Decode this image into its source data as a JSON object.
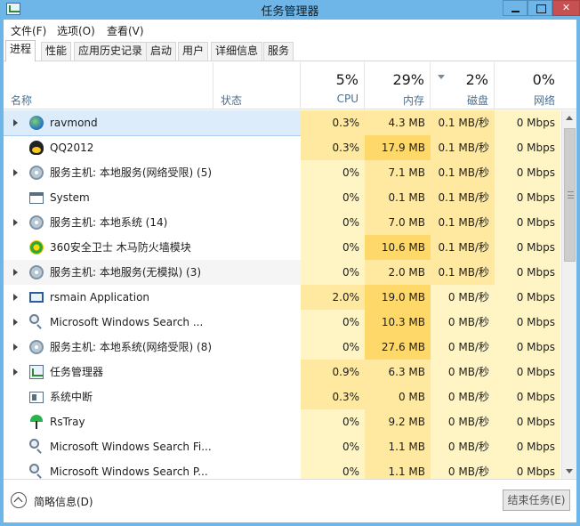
{
  "window": {
    "title": "任务管理器"
  },
  "menu": [
    {
      "label": "文件(F)"
    },
    {
      "label": "选项(O)"
    },
    {
      "label": "查看(V)"
    }
  ],
  "tabs": [
    {
      "label": "进程",
      "active": true
    },
    {
      "label": "性能"
    },
    {
      "label": "应用历史记录"
    },
    {
      "label": "启动"
    },
    {
      "label": "用户"
    },
    {
      "label": "详细信息"
    },
    {
      "label": "服务"
    }
  ],
  "columns": {
    "name": {
      "label": "名称"
    },
    "status": {
      "label": "状态"
    },
    "cpu": {
      "label": "CPU",
      "percent": "5%"
    },
    "memory": {
      "label": "内存",
      "percent": "29%"
    },
    "disk": {
      "label": "磁盘",
      "percent": "2%"
    },
    "network": {
      "label": "网络",
      "percent": "0%"
    }
  },
  "processes": [
    {
      "name": "ravmond",
      "icon": "globe-icon",
      "expandable": true,
      "cpu": "0.3%",
      "memory": "4.3 MB",
      "disk": "0.1 MB/秒",
      "network": "0 Mbps",
      "selected": true
    },
    {
      "name": "QQ2012",
      "icon": "qq-penguin-icon",
      "expandable": false,
      "cpu": "0.3%",
      "memory": "17.9 MB",
      "disk": "0.1 MB/秒",
      "network": "0 Mbps"
    },
    {
      "name": "服务主机: 本地服务(网络受限) (5)",
      "icon": "gear-icon",
      "expandable": true,
      "cpu": "0%",
      "memory": "7.1 MB",
      "disk": "0.1 MB/秒",
      "network": "0 Mbps"
    },
    {
      "name": "System",
      "icon": "window-icon",
      "expandable": false,
      "cpu": "0%",
      "memory": "0.1 MB",
      "disk": "0.1 MB/秒",
      "network": "0 Mbps"
    },
    {
      "name": "服务主机: 本地系统 (14)",
      "icon": "gear-icon",
      "expandable": true,
      "cpu": "0%",
      "memory": "7.0 MB",
      "disk": "0.1 MB/秒",
      "network": "0 Mbps"
    },
    {
      "name": "360安全卫士 木马防火墙模块",
      "icon": "360-shield-icon",
      "expandable": false,
      "cpu": "0%",
      "memory": "10.6 MB",
      "disk": "0.1 MB/秒",
      "network": "0 Mbps"
    },
    {
      "name": "服务主机: 本地服务(无模拟) (3)",
      "icon": "gear-icon",
      "expandable": true,
      "cpu": "0%",
      "memory": "2.0 MB",
      "disk": "0.1 MB/秒",
      "network": "0 Mbps",
      "hover": true
    },
    {
      "name": "rsmain Application",
      "icon": "app-window-icon",
      "expandable": true,
      "cpu": "2.0%",
      "memory": "19.0 MB",
      "disk": "0 MB/秒",
      "network": "0 Mbps"
    },
    {
      "name": "Microsoft Windows Search ...",
      "icon": "search-user-icon",
      "expandable": true,
      "cpu": "0%",
      "memory": "10.3 MB",
      "disk": "0 MB/秒",
      "network": "0 Mbps"
    },
    {
      "name": "服务主机: 本地系统(网络受限) (8)",
      "icon": "gear-icon",
      "expandable": true,
      "cpu": "0%",
      "memory": "27.6 MB",
      "disk": "0 MB/秒",
      "network": "0 Mbps"
    },
    {
      "name": "任务管理器",
      "icon": "task-manager-icon",
      "expandable": true,
      "cpu": "0.9%",
      "memory": "6.3 MB",
      "disk": "0 MB/秒",
      "network": "0 Mbps"
    },
    {
      "name": "系统中断",
      "icon": "interrupt-icon",
      "expandable": false,
      "cpu": "0.3%",
      "memory": "0 MB",
      "disk": "0 MB/秒",
      "network": "0 Mbps"
    },
    {
      "name": "RsTray",
      "icon": "umbrella-icon",
      "expandable": false,
      "cpu": "0%",
      "memory": "9.2 MB",
      "disk": "0 MB/秒",
      "network": "0 Mbps"
    },
    {
      "name": "Microsoft Windows Search Fi...",
      "icon": "search-user-icon",
      "expandable": false,
      "cpu": "0%",
      "memory": "1.1 MB",
      "disk": "0 MB/秒",
      "network": "0 Mbps"
    },
    {
      "name": "Microsoft Windows Search P...",
      "icon": "search-user-icon",
      "expandable": false,
      "cpu": "0%",
      "memory": "1.1 MB",
      "disk": "0 MB/秒",
      "network": "0 Mbps"
    }
  ],
  "footer": {
    "fewer_details": "简略信息(D)",
    "end_task": "结束任务(E)"
  }
}
